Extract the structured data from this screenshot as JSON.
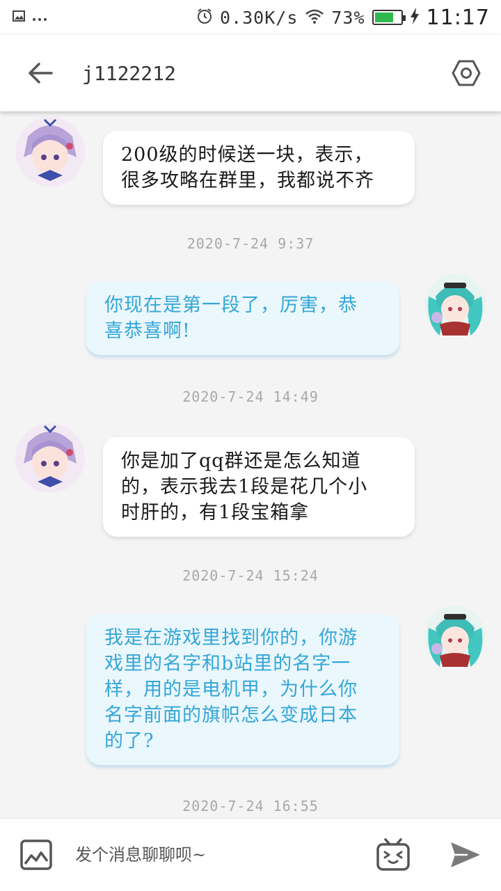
{
  "status_bar": {
    "network_speed": "0.30K/s",
    "battery_percent": "73%",
    "battery_level": 0.73,
    "time": "11:17",
    "icons": [
      "image-icon",
      "more-dots-icon",
      "alarm-icon",
      "wifi-icon",
      "battery-icon",
      "charging-icon"
    ]
  },
  "header": {
    "title": "j1122212",
    "back_icon": "back-arrow-icon",
    "settings_icon": "hexagon-settings-icon"
  },
  "messages": [
    {
      "side": "left",
      "lines": [
        "200级的时候送一块，表示，",
        "很多攻略在群里，我都说不齐"
      ]
    },
    {
      "timestamp": "2020-7-24 9:37"
    },
    {
      "side": "right",
      "lines": [
        "你现在是第一段了，厉害，恭",
        "喜恭喜啊!"
      ]
    },
    {
      "timestamp": "2020-7-24 14:49"
    },
    {
      "side": "left",
      "lines": [
        "你是加了qq群还是怎么知道",
        "的，表示我去1段是花几个小",
        "时肝的，有1段宝箱拿"
      ]
    },
    {
      "timestamp": "2020-7-24 15:24"
    },
    {
      "side": "right",
      "lines": [
        "我是在游戏里找到你的，你游",
        "戏里的名字和b站里的名字一",
        "样，用的是电机甲，为什么你",
        "名字前面的旗帜怎么变成日本",
        "的了?"
      ]
    },
    {
      "timestamp": "2020-7-24 16:55"
    }
  ],
  "input": {
    "placeholder": "发个消息聊聊呗~"
  },
  "colors": {
    "accent_text": "#34a6d6",
    "right_bubble_bg": "#eaf7fd",
    "background": "#f4f4f5",
    "battery": "#2fb84e"
  }
}
